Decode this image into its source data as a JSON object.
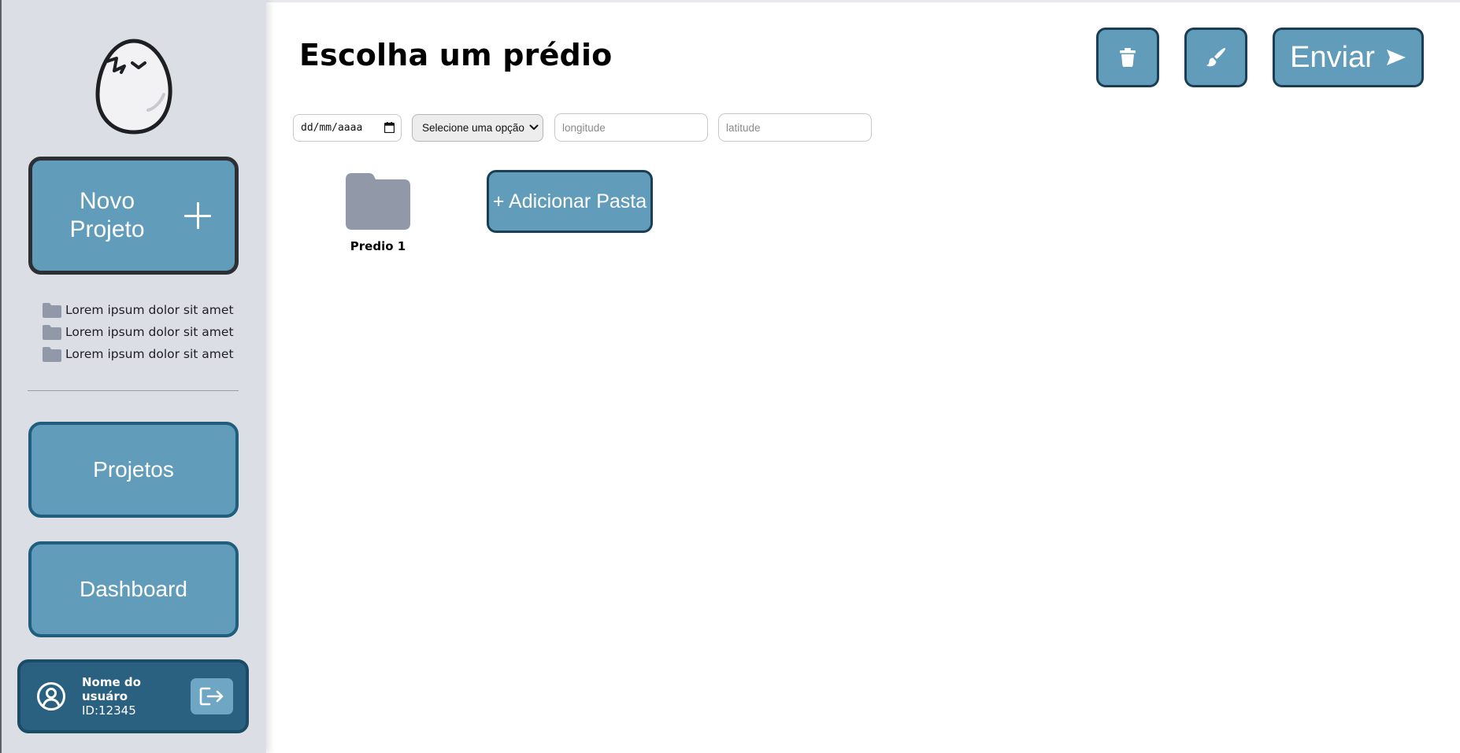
{
  "app": {
    "page_title": "Escolha um prédio"
  },
  "sidebar": {
    "new_project_label": "Novo Projeto",
    "projects": [
      {
        "label": "Lorem ipsum dolor sit amet"
      },
      {
        "label": "Lorem ipsum dolor sit amet"
      },
      {
        "label": "Lorem ipsum dolor sit amet"
      }
    ],
    "nav": {
      "projetos": "Projetos",
      "dashboard": "Dashboard"
    },
    "user": {
      "name": "Nome do usuáro",
      "id": "ID:12345"
    }
  },
  "toolbar": {
    "send_label": "Enviar",
    "trash_icon": "trash-icon",
    "brush_icon": "paintbrush-icon",
    "send_icon": "send-arrow-icon"
  },
  "filters": {
    "date_value": "dd/mm/aaaa",
    "select_value": "Selecione uma opção",
    "longitude_placeholder": "longitude",
    "latitude_placeholder": "latitude"
  },
  "folders": [
    {
      "name": "Predio 1"
    }
  ],
  "add_folder_label": "+ Adicionar Pasta",
  "colors": {
    "sidebar_bg": "#dcdee5",
    "accent": "#629cbb",
    "accent_border": "#1a3e54",
    "user_card": "#2b6180",
    "folder_icon": "#9199a9"
  }
}
